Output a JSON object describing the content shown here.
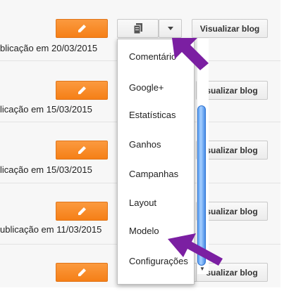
{
  "rows": [
    {
      "date_text": "blicação em 20/03/2015",
      "view_label": "Visualizar blog"
    },
    {
      "date_text": "licação em 15/03/2015",
      "view_label": "sualizar blog"
    },
    {
      "date_text": "licação em 15/03/2015",
      "view_label": "sualizar blog"
    },
    {
      "date_text": "ublicação em 11/03/2015",
      "view_label": "sualizar blog"
    },
    {
      "date_text": "",
      "view_label": "sualizar blog"
    }
  ],
  "menu": {
    "items": [
      "Comentário",
      "Google+",
      "Estatísticas",
      "Ganhos",
      "Campanhas",
      "Layout",
      "Modelo",
      "Configurações"
    ]
  },
  "icons": {
    "edit": "pencil-icon",
    "copy": "document-stack-icon",
    "dropdown": "caret-down-icon"
  },
  "colors": {
    "edit_button": "#f57f17",
    "annotation_arrow": "#7b1fa2",
    "scroll_thumb": "#5aa0f2"
  }
}
